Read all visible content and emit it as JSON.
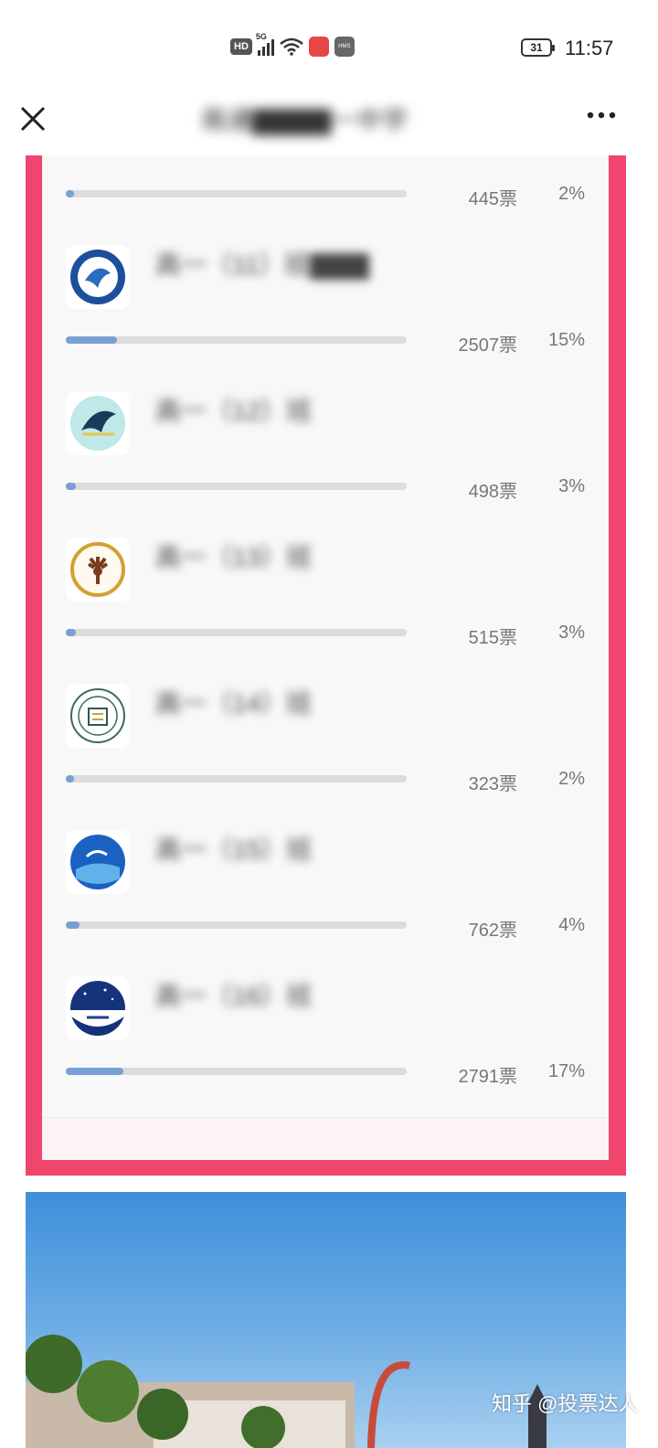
{
  "status_bar": {
    "hd": "HD",
    "network": "5G",
    "app_badge": "HMS",
    "battery": "31",
    "time": "11:57"
  },
  "nav": {
    "close_icon": "close-icon",
    "title": "南通▇▇▇▇一中学",
    "more_icon": "more-icon"
  },
  "first_row": {
    "votes": "445票",
    "percent": "2%",
    "fraction": 0.02
  },
  "entries": [
    {
      "name": "高一（11）班▇▇▇",
      "votes": "2507票",
      "percent": "15%",
      "fraction": 0.15,
      "logo_icon": "class-emblem-blue-bird-icon"
    },
    {
      "name": "高一（12）班",
      "votes": "498票",
      "percent": "3%",
      "fraction": 0.03,
      "logo_icon": "class-emblem-wing-icon"
    },
    {
      "name": "高一（13）班",
      "votes": "515票",
      "percent": "3%",
      "fraction": 0.03,
      "logo_icon": "class-emblem-deer-icon"
    },
    {
      "name": "高一（14）班",
      "votes": "323票",
      "percent": "2%",
      "fraction": 0.02,
      "logo_icon": "class-emblem-school-seal-icon"
    },
    {
      "name": "高一（15）班",
      "votes": "762票",
      "percent": "4%",
      "fraction": 0.04,
      "logo_icon": "class-emblem-blue-sky-icon"
    },
    {
      "name": "高一（16）班",
      "votes": "2791票",
      "percent": "17%",
      "fraction": 0.17,
      "logo_icon": "class-emblem-starry-icon"
    }
  ],
  "watermark": "知乎 @投票达人",
  "colors": {
    "frame": "#f0466e",
    "progress_fill": "#78a0d4",
    "progress_track": "#dcdcdc"
  }
}
